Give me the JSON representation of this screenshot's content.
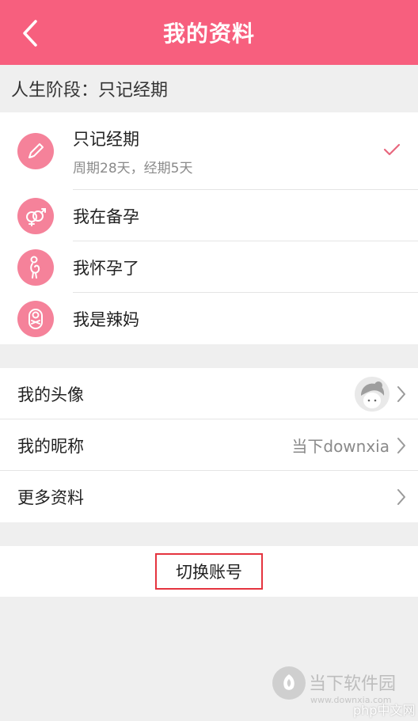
{
  "header": {
    "title": "我的资料",
    "bg_color": "#f75f7e"
  },
  "stage": {
    "heading": "人生阶段：只记经期",
    "items": [
      {
        "label": "只记经期",
        "sub": "周期28天，经期5天",
        "selected": true,
        "icon": "pen-icon"
      },
      {
        "label": "我在备孕",
        "icon": "gender-couple-icon"
      },
      {
        "label": "我怀孕了",
        "icon": "pregnant-icon"
      },
      {
        "label": "我是辣妈",
        "icon": "baby-icon"
      }
    ]
  },
  "settings": {
    "avatar_label": "我的头像",
    "nickname_label": "我的昵称",
    "nickname_value": "当下downxia",
    "more_label": "更多资料"
  },
  "switch_account": {
    "label": "切换账号"
  },
  "watermark": {
    "site_name": "当下软件园",
    "site_url": "www.downxia.com",
    "php_label": "php中文网"
  },
  "colors": {
    "accent": "#f75f7e",
    "icon_bg": "#f5829a",
    "check": "#e8677e",
    "highlight_border": "#e5343f"
  }
}
